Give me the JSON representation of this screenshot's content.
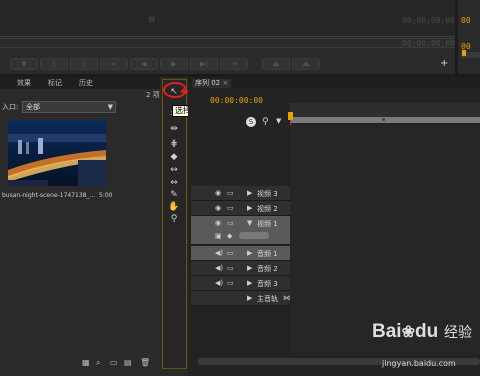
{
  "monitor": {
    "left_timecode": "00;00;00;00",
    "right_timecode": "00;00;00;00",
    "right_timecode_partial": "00",
    "far_right_timecode_partial": "00",
    "plus_label": "+"
  },
  "project_panel": {
    "tabs": [
      "效果",
      "标记",
      "历史"
    ],
    "count_label": "2 项",
    "entry_label": "入口:",
    "entry_value": "全部",
    "clip_name": "busan-night-scene-1747138_...",
    "clip_duration": "5:00"
  },
  "tools": {
    "tooltip": "选择工具 (V)"
  },
  "sequence": {
    "tab_label": "序列 02",
    "timecode": "00:00:00:00",
    "tracks": [
      {
        "label": "视频 3",
        "type": "video"
      },
      {
        "label": "视频 2",
        "type": "video"
      },
      {
        "label": "视频 1",
        "type": "video"
      },
      {
        "label": "音频 1",
        "type": "audio"
      },
      {
        "label": "音频 2",
        "type": "audio"
      },
      {
        "label": "音频 3",
        "type": "audio"
      },
      {
        "label": "主音轨",
        "type": "master"
      }
    ]
  },
  "watermark": {
    "brand": "Bai",
    "brand2": "du",
    "suffix": "经验",
    "url": "jingyan.baidu.com"
  },
  "colors": {
    "accent_orange": "#e8a000",
    "playhead_red": "#c0392b",
    "tooltip_bg": "#ffffe1",
    "highlight_red": "#e02020"
  }
}
